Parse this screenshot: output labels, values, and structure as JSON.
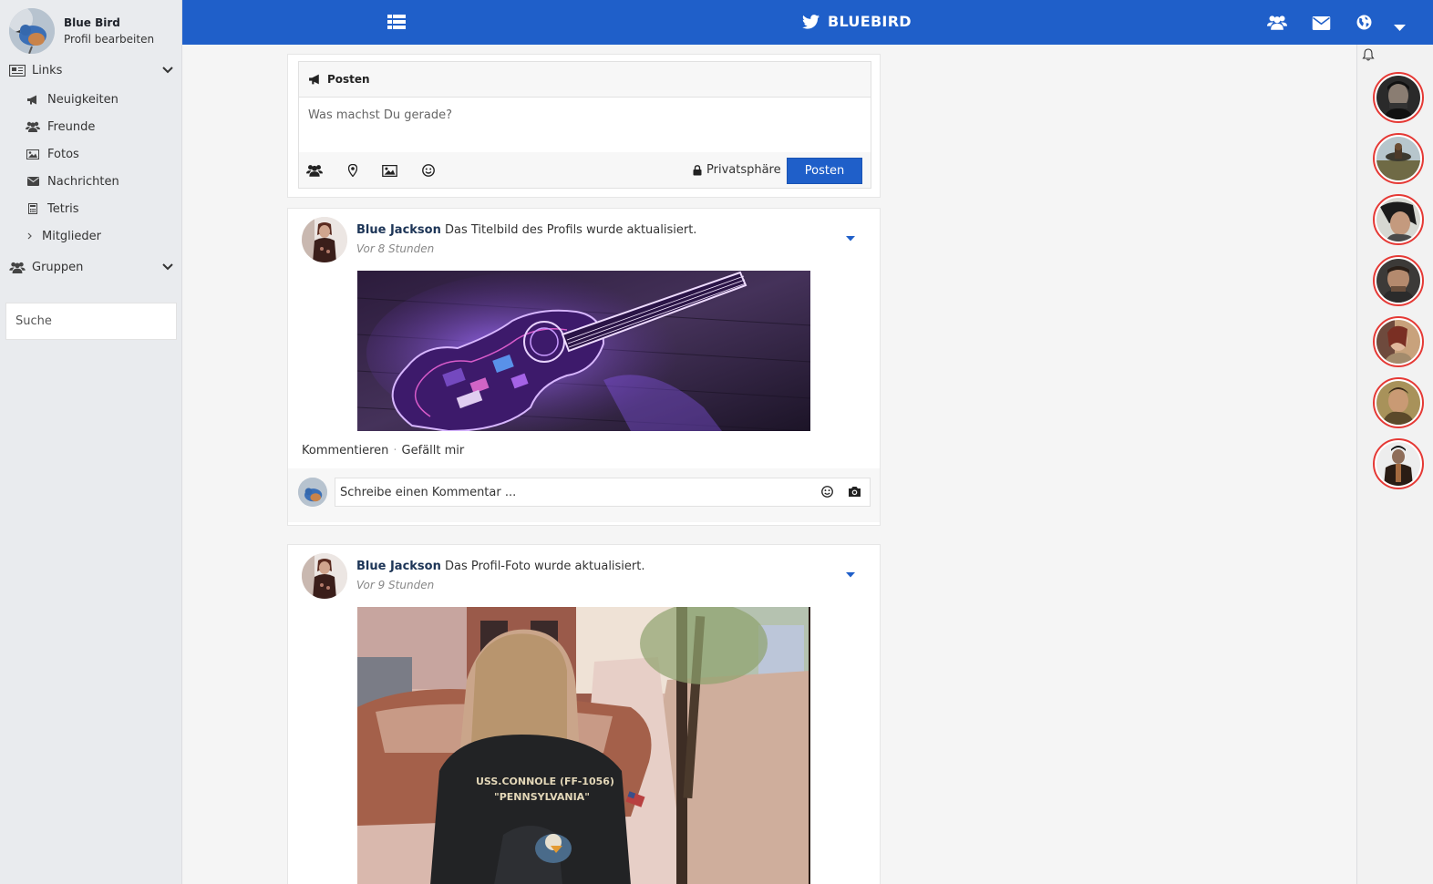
{
  "sidebar": {
    "profile": {
      "name": "Blue Bird",
      "edit_label": "Profil bearbeiten"
    },
    "links_section": {
      "label": "Links",
      "icon": "newspaper-icon"
    },
    "items": [
      {
        "label": "Neuigkeiten",
        "icon": "bullhorn-icon"
      },
      {
        "label": "Freunde",
        "icon": "users-icon"
      },
      {
        "label": "Fotos",
        "icon": "image-icon"
      },
      {
        "label": "Nachrichten",
        "icon": "envelope-icon"
      },
      {
        "label": "Tetris",
        "icon": "calculator-icon"
      },
      {
        "label": "Mitglieder",
        "icon": "chevron-right-icon"
      }
    ],
    "groups_section": {
      "label": "Gruppen",
      "icon": "users-icon"
    },
    "search": {
      "placeholder": "Suche"
    }
  },
  "topbar": {
    "brand": "BLUEBIRD",
    "accent": "#1f5fc9"
  },
  "composer": {
    "title": "Posten",
    "placeholder": "Was machst Du gerade?",
    "privacy_label": "Privatsphäre",
    "post_button": "Posten"
  },
  "posts": [
    {
      "author": "Blue Jackson",
      "action": "Das Titelbild des Profils wurde aktualisiert.",
      "time": "Vor 8 Stunden",
      "comment_label": "Kommentieren",
      "like_label": "Gefällt mir",
      "comment_placeholder": "Schreibe einen Kommentar ..."
    },
    {
      "author": "Blue Jackson",
      "action": "Das Profil-Foto wurde aktualisiert.",
      "time": "Vor 9 Stunden"
    }
  ],
  "shirt_text": {
    "line1": "USS.CONNOLE (FF-1056)",
    "line2": "\"PENNSYLVANIA\""
  },
  "status_color": "#e53935"
}
